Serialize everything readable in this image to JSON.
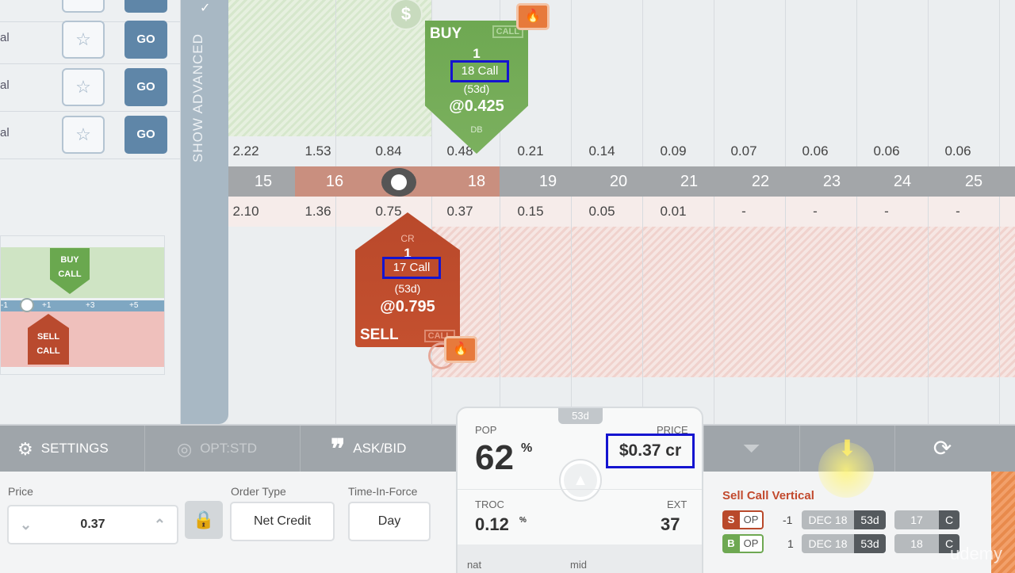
{
  "left_panel": {
    "rows": [
      {
        "label": "al",
        "go": "GO"
      },
      {
        "label": "al",
        "go": "GO"
      },
      {
        "label": "al",
        "go": "GO"
      }
    ],
    "show_advanced": "SHOW ADVANCED",
    "mini_chart": {
      "buy_label": "BUY CALL",
      "sell_label": "SELL CALL",
      "axis_ticks": [
        "-1",
        "+1",
        "+3",
        "+5"
      ]
    }
  },
  "chart": {
    "buy_pin": {
      "action": "BUY",
      "kind": "CALL",
      "qty": "1",
      "strike": "18 Call",
      "days": "(53d)",
      "price": "@0.425",
      "tag": "DB"
    },
    "sell_pin": {
      "action": "SELL",
      "kind": "CALL",
      "qty": "1",
      "tag": "CR",
      "strike": "17 Call",
      "days": "(53d)",
      "price": "@0.795"
    },
    "call_prices": [
      "2.22",
      "1.53",
      "0.84",
      "0.48",
      "0.21",
      "0.14",
      "0.09",
      "0.07",
      "0.06",
      "0.06",
      "0.06"
    ],
    "strikes": [
      "15",
      "16",
      "17",
      "18",
      "19",
      "20",
      "21",
      "22",
      "23",
      "24",
      "25"
    ],
    "put_prices": [
      "2.10",
      "1.36",
      "0.75",
      "0.37",
      "0.15",
      "0.05",
      "0.01",
      "-",
      "-",
      "-",
      "-"
    ],
    "dollar_icon": "$"
  },
  "toolbar": {
    "settings": "SETTINGS",
    "opt": "OPT:STD",
    "askbid": "ASK/BID"
  },
  "order": {
    "price_label": "Price",
    "price_value": "0.37",
    "order_type_label": "Order Type",
    "order_type_value": "Net Credit",
    "tif_label": "Time-In-Force",
    "tif_value": "Day"
  },
  "ticket": {
    "days": "53d",
    "pop_label": "POP",
    "pop_value": "62",
    "pop_unit": "%",
    "price_label": "PRICE",
    "price_value": "$0.37 cr",
    "troc_label": "TROC",
    "troc_value": "0.12",
    "troc_unit": "%",
    "ext_label": "EXT",
    "ext_value": "37",
    "nat_label": "nat",
    "mid_label": "mid"
  },
  "strategy": {
    "title": "Sell Call Vertical",
    "legs": [
      {
        "side": "S",
        "op": "OP",
        "qty": "-1",
        "exp": "DEC 18",
        "days": "53d",
        "strike": "17",
        "type": "C"
      },
      {
        "side": "B",
        "op": "OP",
        "qty": "1",
        "exp": "DEC 18",
        "days": "53d",
        "strike": "18",
        "type": "C"
      }
    ]
  },
  "watermark": "udemy",
  "colors": {
    "buy_green": "#6ea852",
    "sell_red": "#b9492b",
    "highlight_box": "#1414d0",
    "go_blue": "#5f86a8"
  }
}
